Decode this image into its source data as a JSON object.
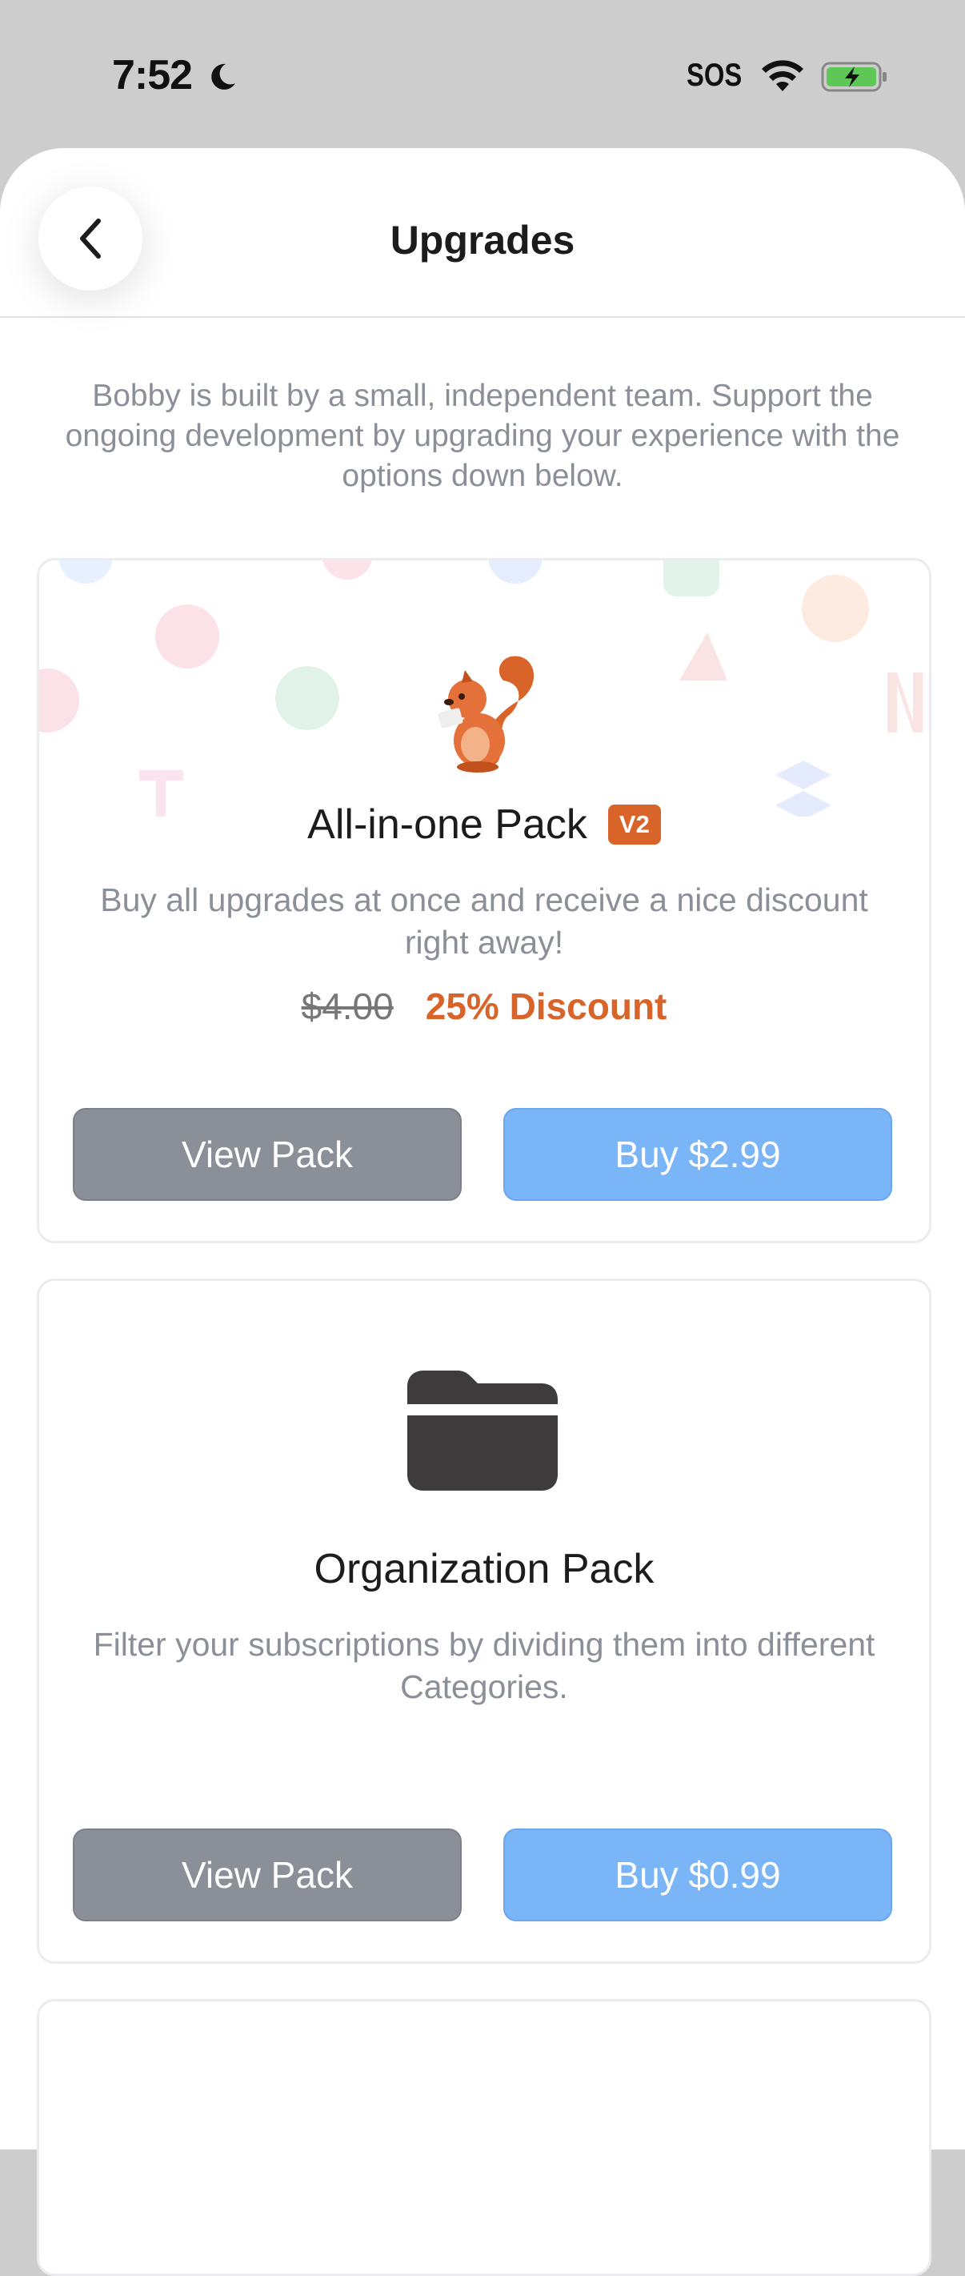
{
  "status_bar": {
    "time": "7:52",
    "carrier": "SOS",
    "icons": [
      "moon-icon",
      "wifi-icon",
      "battery-charging-icon"
    ]
  },
  "nav": {
    "title": "Upgrades",
    "back_icon": "chevron-left-icon"
  },
  "intro": "Bobby is built by a small, independent team. Support the ongoing development by upgrading your experience with the options down below.",
  "packs": [
    {
      "icon": "squirrel-icon",
      "title": "All-in-one Pack",
      "badge": "V2",
      "description": "Buy all upgrades at once and receive a nice discount right away!",
      "old_price": "$4.00",
      "discount": "25% Discount",
      "view_label": "View Pack",
      "buy_label": "Buy $2.99"
    },
    {
      "icon": "folder-icon",
      "title": "Organization Pack",
      "description": "Filter your subscriptions by dividing them into different Categories.",
      "view_label": "View Pack",
      "buy_label": "Buy $0.99"
    }
  ],
  "colors": {
    "accent_orange": "#d9642a",
    "buy_blue": "#7ab5f8",
    "view_gray": "#8b8f98"
  }
}
